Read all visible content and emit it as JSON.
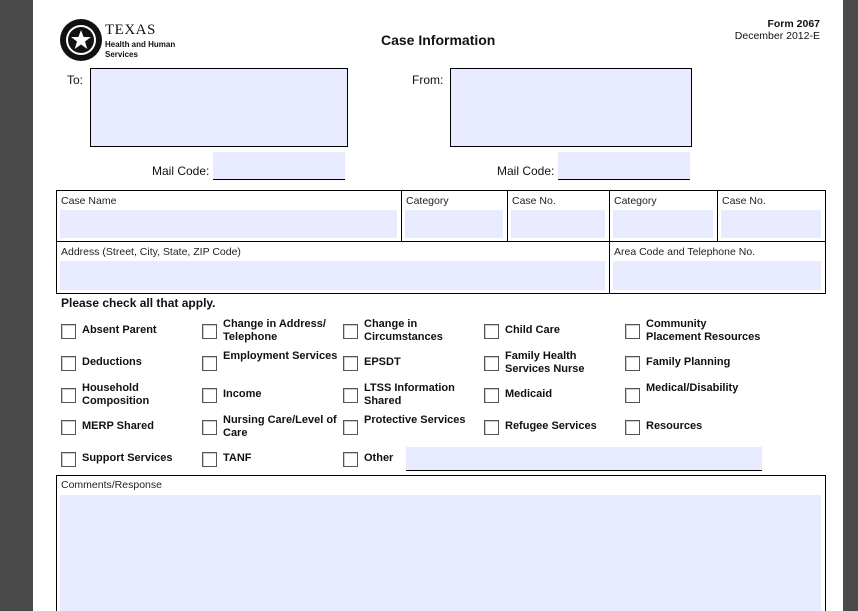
{
  "logo": {
    "name": "TEXAS",
    "sub1": "Health and Human",
    "sub2": "Services"
  },
  "header": {
    "title": "Case Information",
    "form_number": "Form 2067",
    "form_date": "December 2012-E"
  },
  "routing": {
    "to_label": "To:",
    "from_label": "From:",
    "mail_code_label": "Mail Code:"
  },
  "table": {
    "case_name": "Case Name",
    "category": "Category",
    "case_no": "Case No.",
    "address": "Address (Street, City, State, ZIP Code)",
    "phone": "Area Code and Telephone No."
  },
  "checklist": {
    "heading": "Please check all that apply.",
    "items": [
      [
        "Absent Parent",
        "Change in Address/ Telephone",
        "Change in Circumstances",
        "Child Care",
        "Community Placement Resources"
      ],
      [
        "Deductions",
        "Employment Services",
        "EPSDT",
        "Family Health Services Nurse",
        "Family Planning"
      ],
      [
        "Household Composition",
        "Income",
        "LTSS Information Shared",
        "Medicaid",
        "Medical/Disability"
      ],
      [
        "MERP Shared",
        "Nursing Care/Level of Care",
        "Protective Services",
        "Refugee Services",
        "Resources"
      ],
      [
        "Support Services",
        "TANF",
        "Other"
      ]
    ]
  },
  "comments": {
    "label": "Comments/Response"
  },
  "footer": {
    "partial_label": "Area Code and Telephone No."
  }
}
